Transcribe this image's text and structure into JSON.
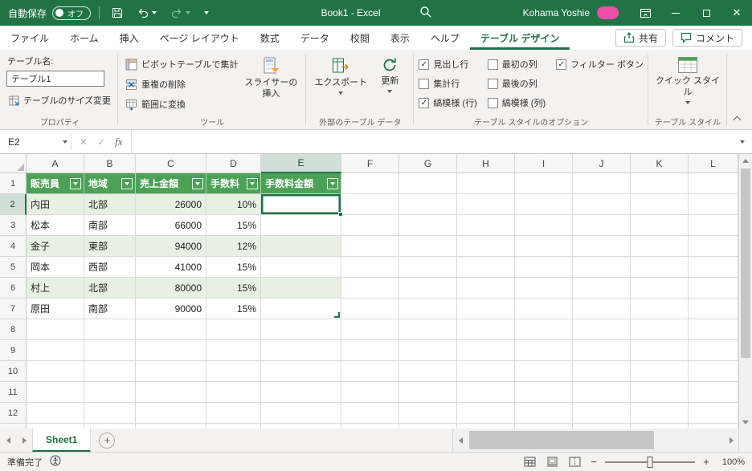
{
  "title_bar": {
    "autosave_label": "自動保存",
    "autosave_state": "オフ",
    "document_title": "Book1 - Excel",
    "user_name": "Kohama Yoshie"
  },
  "ribbon_tabs": [
    {
      "label": "ファイル",
      "active": false
    },
    {
      "label": "ホーム",
      "active": false
    },
    {
      "label": "挿入",
      "active": false
    },
    {
      "label": "ページ レイアウト",
      "active": false
    },
    {
      "label": "数式",
      "active": false
    },
    {
      "label": "データ",
      "active": false
    },
    {
      "label": "校閲",
      "active": false
    },
    {
      "label": "表示",
      "active": false
    },
    {
      "label": "ヘルプ",
      "active": false
    },
    {
      "label": "テーブル デザイン",
      "active": true
    }
  ],
  "quick_actions": {
    "share_label": "共有",
    "comments_label": "コメント"
  },
  "ribbon": {
    "table_name_label": "テーブル名:",
    "table_name_value": "テーブル1",
    "resize_table_label": "テーブルのサイズ変更",
    "group_properties": "プロパティ",
    "pivot_label": "ピボットテーブルで集計",
    "dedupe_label": "重複の削除",
    "range_label": "範囲に変換",
    "slicer_label": "スライサーの挿入",
    "group_tools": "ツール",
    "export_label": "エクスポート",
    "refresh_label": "更新",
    "group_external": "外部のテーブル データ",
    "options": [
      {
        "label": "見出し行",
        "checked": true
      },
      {
        "label": "集計行",
        "checked": false
      },
      {
        "label": "縞模様 (行)",
        "checked": true
      },
      {
        "label": "最初の列",
        "checked": false
      },
      {
        "label": "最後の列",
        "checked": false
      },
      {
        "label": "縞模様 (列)",
        "checked": false
      },
      {
        "label": "フィルター ボタン",
        "checked": true
      }
    ],
    "group_options": "テーブル スタイルのオプション",
    "quick_styles_label": "クイック スタイル",
    "group_styles": "テーブル スタイル"
  },
  "formula_bar": {
    "name_box": "E2",
    "fx_label": "fx",
    "formula_value": ""
  },
  "grid": {
    "columns": [
      "A",
      "B",
      "C",
      "D",
      "E",
      "F",
      "G",
      "H",
      "I",
      "J",
      "K",
      "L"
    ],
    "row_labels": [
      "1",
      "2",
      "3",
      "4",
      "5",
      "6",
      "7",
      "8",
      "9",
      "10",
      "11",
      "12"
    ],
    "selected_cell": "E2",
    "selected_column": "E",
    "selected_row": "2",
    "table": {
      "headers": [
        "販売員",
        "地域",
        "売上金額",
        "手数料",
        "手数料金額"
      ],
      "rows": [
        [
          "内田",
          "北部",
          "26000",
          "10%",
          ""
        ],
        [
          "松本",
          "南部",
          "66000",
          "15%",
          ""
        ],
        [
          "金子",
          "東部",
          "94000",
          "12%",
          ""
        ],
        [
          "岡本",
          "西部",
          "41000",
          "15%",
          ""
        ],
        [
          "村上",
          "北部",
          "80000",
          "15%",
          ""
        ],
        [
          "原田",
          "南部",
          "90000",
          "15%",
          ""
        ]
      ]
    }
  },
  "sheet_bar": {
    "active_sheet": "Sheet1"
  },
  "status_bar": {
    "ready_label": "準備完了",
    "zoom_value": "100%"
  }
}
